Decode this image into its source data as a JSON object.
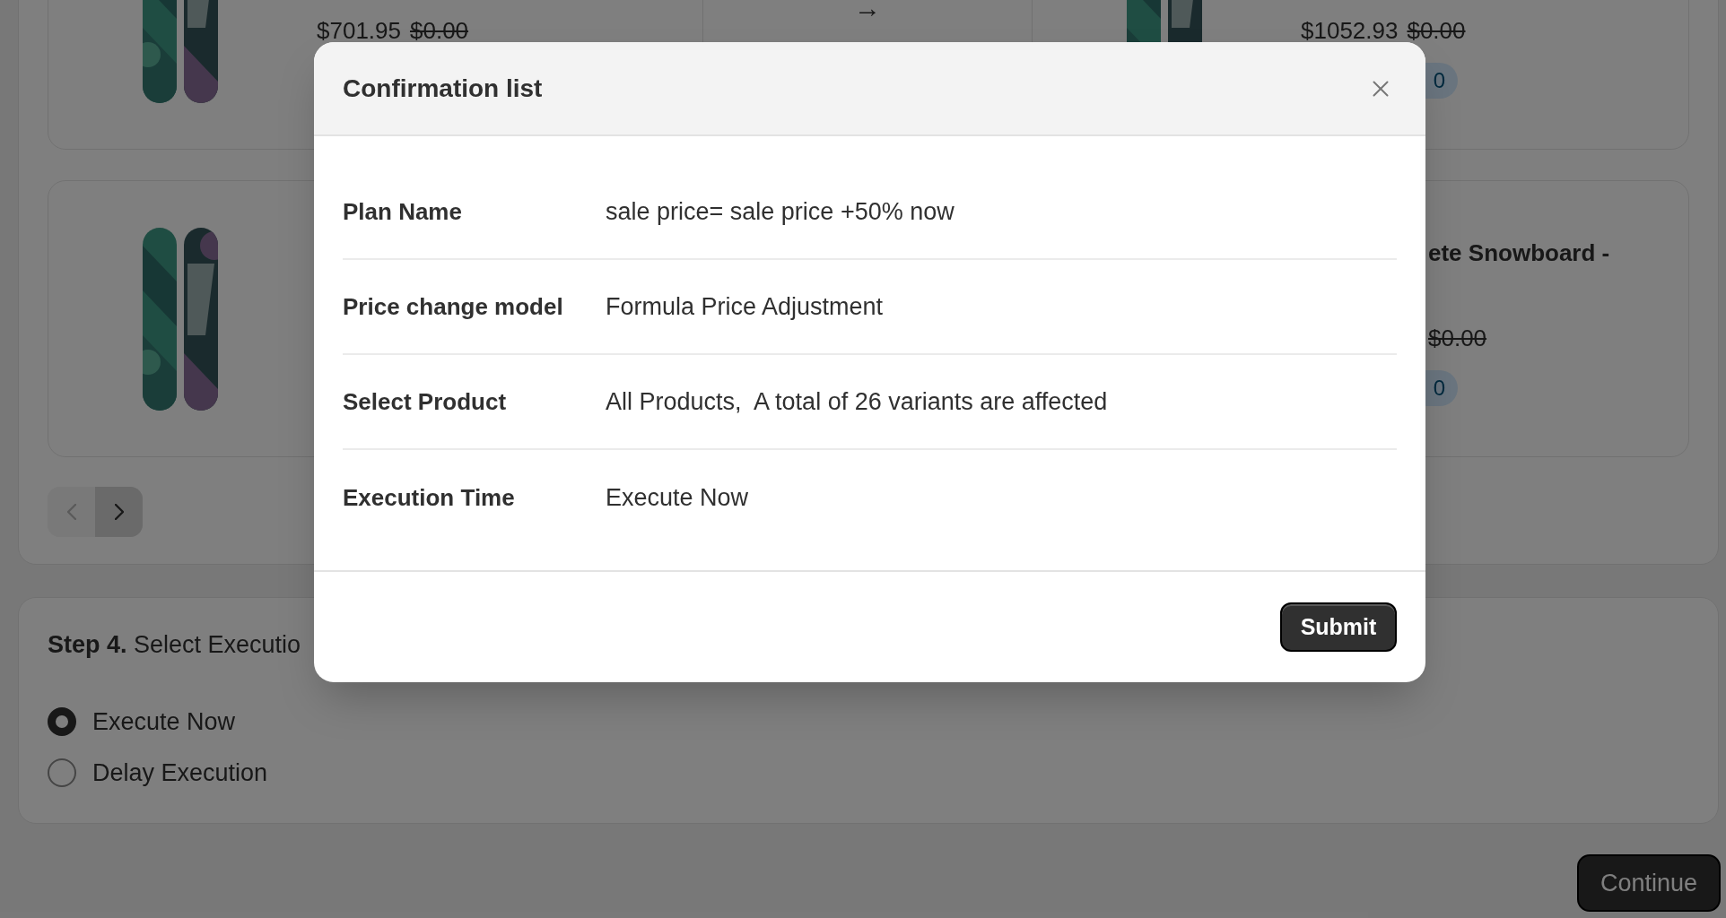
{
  "page": {
    "product_rows": [
      {
        "left": {
          "sale_price": "$701.95",
          "compare_price": "$0.00"
        },
        "arrow": "→",
        "right": {
          "sale_price": "$1052.93",
          "compare_price": "$0.00",
          "badge": "0"
        }
      },
      {
        "right": {
          "title": "ete Snowboard -",
          "compare_price": "$0.00",
          "badge": "0"
        }
      }
    ],
    "pager": [
      {
        "kind": "previous",
        "disabled": true
      },
      {
        "kind": "next",
        "disabled": false
      }
    ],
    "step4": {
      "heading": "**Step 4.** Select Executio",
      "options": [
        {
          "label": "Execute Now",
          "selected": true
        },
        {
          "label": "Delay Execution",
          "selected": false
        }
      ]
    },
    "continue_button": "Continue"
  },
  "dialog": {
    "title": "Confirmation list",
    "rows": [
      {
        "label": "Plan Name",
        "value": "sale price= sale price +50% now"
      },
      {
        "label": "Price change model",
        "value": "Formula Price Adjustment"
      },
      {
        "label": "Select Product",
        "value": "All Products,  A total of 26 variants are affected"
      },
      {
        "label": "Execution Time",
        "value": "Execute Now"
      }
    ],
    "submit_button": "Submit"
  }
}
